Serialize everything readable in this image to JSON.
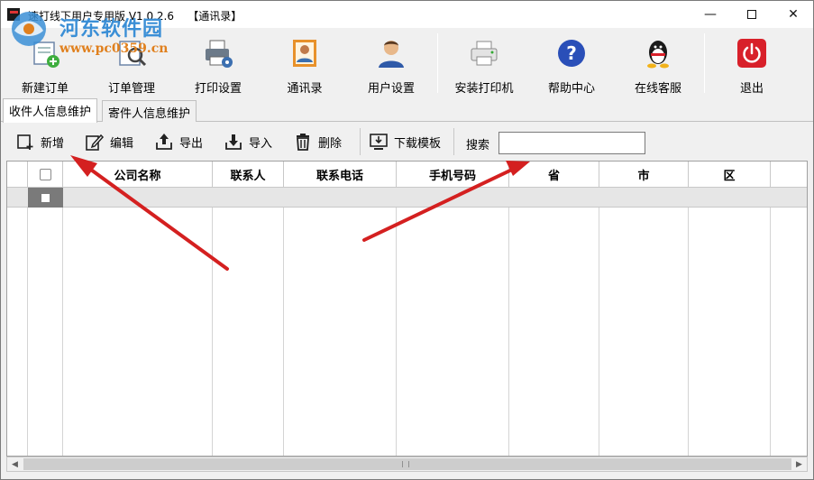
{
  "window": {
    "title": "速打线下用户专用版 V1.0.2.6    【通讯录】",
    "minimize_glyph": "—",
    "close_glyph": "✕"
  },
  "watermark": {
    "text": "河东软件园",
    "url": "www.pc0359.cn"
  },
  "toolbar": {
    "items": [
      {
        "label": "新建订单",
        "icon": "new-order-icon"
      },
      {
        "label": "订单管理",
        "icon": "order-manage-icon"
      },
      {
        "label": "打印设置",
        "icon": "print-settings-icon"
      },
      {
        "label": "通讯录",
        "icon": "contacts-icon"
      },
      {
        "label": "用户设置",
        "icon": "user-settings-icon"
      },
      {
        "label": "安装打印机",
        "icon": "printer-icon"
      },
      {
        "label": "帮助中心",
        "icon": "help-icon"
      },
      {
        "label": "在线客服",
        "icon": "qq-icon"
      },
      {
        "label": "退出",
        "icon": "power-icon"
      }
    ]
  },
  "tabs": [
    {
      "label": "收件人信息维护",
      "active": true
    },
    {
      "label": "寄件人信息维护",
      "active": false
    }
  ],
  "actions": {
    "add": "新增",
    "edit": "编辑",
    "export": "导出",
    "import": "导入",
    "delete": "删除",
    "download_template": "下载模板",
    "search_label": "搜索",
    "search_value": ""
  },
  "table": {
    "columns": [
      "公司名称",
      "联系人",
      "联系电话",
      "手机号码",
      "省",
      "市",
      "区"
    ],
    "rows": []
  },
  "colors": {
    "arrow": "#d42020",
    "watermark_blue": "#3b8fd6",
    "watermark_orange": "#e0801e",
    "exit_red": "#d8202a",
    "help_blue": "#2a4fb8"
  }
}
